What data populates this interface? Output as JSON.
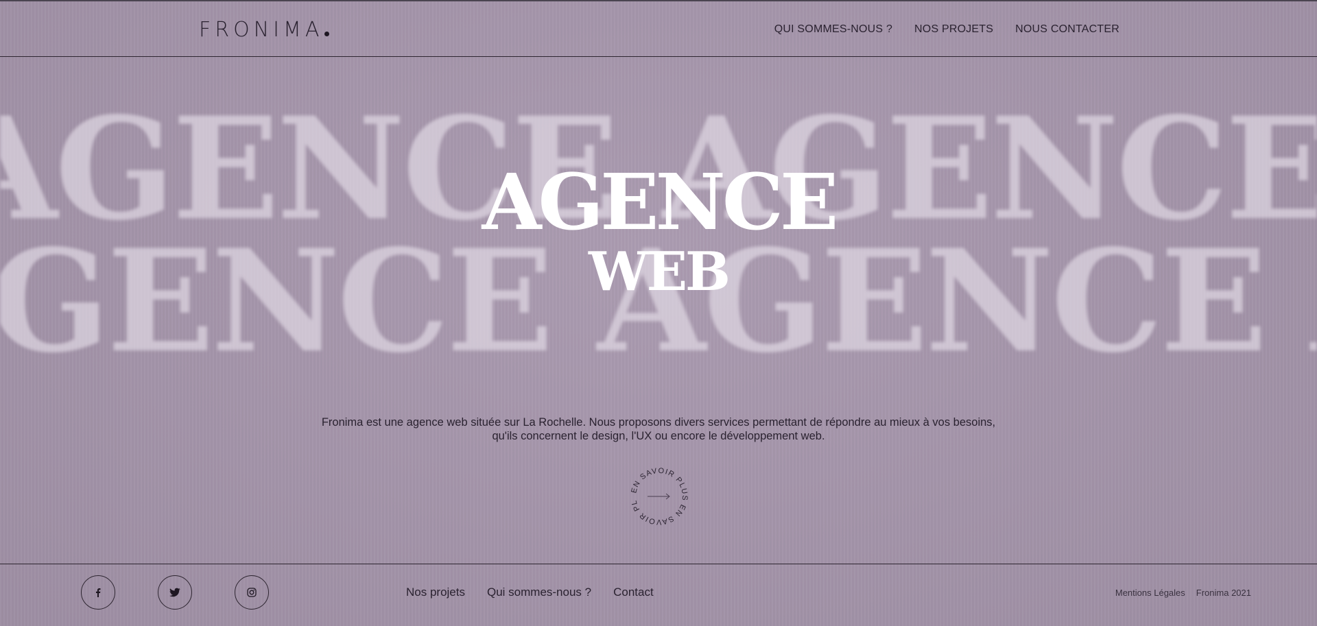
{
  "colors": {
    "background": "#a696ac",
    "text_dark": "#2a2230",
    "hero_text": "#ffffff",
    "background_text": "#e8e2ec"
  },
  "header": {
    "logo": "FRONIMA",
    "nav": [
      {
        "label": "QUI SOMMES-NOUS ?"
      },
      {
        "label": "NOS PROJETS"
      },
      {
        "label": "NOUS CONTACTER"
      }
    ]
  },
  "background_words": {
    "row1": "AGENCE AGENCE AGENCE",
    "row2": "AGENCE AGENCE AGENCE"
  },
  "hero": {
    "line1": "AGENCE",
    "line2": "WEB",
    "description": "Fronima est une agence web située sur La Rochelle. Nous proposons divers services permettant de répondre au mieux à vos besoins, qu'ils concernent le design, l'UX ou encore le développement web.",
    "more_button": {
      "circle_text": "EN SAVOIR PLUS    EN SAVOIR PLUS    ",
      "icon": "arrow-right-icon"
    }
  },
  "footer": {
    "social": [
      {
        "icon": "facebook-icon"
      },
      {
        "icon": "twitter-icon"
      },
      {
        "icon": "instagram-icon"
      }
    ],
    "nav": [
      {
        "label": "Nos projets"
      },
      {
        "label": "Qui sommes-nous ?"
      },
      {
        "label": "Contact"
      }
    ],
    "legal": "Mentions Légales",
    "copyright": "Fronima 2021"
  }
}
